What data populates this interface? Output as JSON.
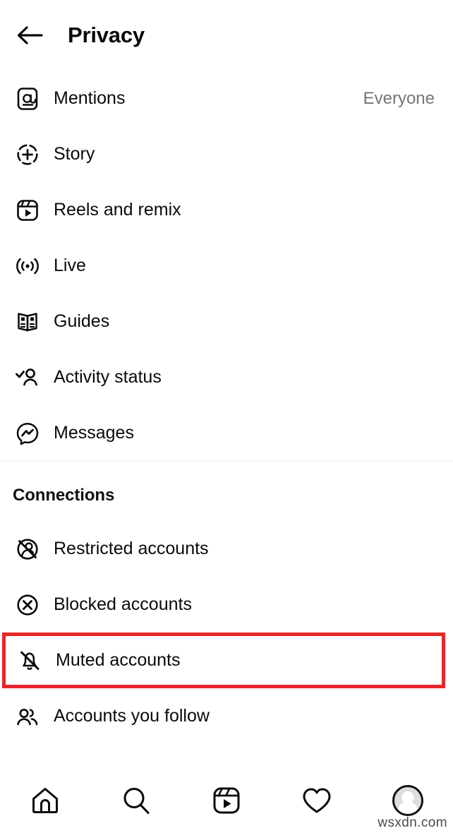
{
  "header": {
    "back_icon": "arrow-left-icon",
    "title": "Privacy"
  },
  "main": {
    "interactions_items": [
      {
        "label": "Mentions",
        "icon": "at-mention-icon",
        "value": "Everyone"
      },
      {
        "label": "Story",
        "icon": "story-plus-icon",
        "value": ""
      },
      {
        "label": "Reels and remix",
        "icon": "reels-icon",
        "value": ""
      },
      {
        "label": "Live",
        "icon": "live-broadcast-icon",
        "value": ""
      },
      {
        "label": "Guides",
        "icon": "guides-book-icon",
        "value": ""
      },
      {
        "label": "Activity status",
        "icon": "person-check-icon",
        "value": ""
      },
      {
        "label": "Messages",
        "icon": "messenger-icon",
        "value": ""
      }
    ],
    "connections_section_title": "Connections",
    "connections_items": [
      {
        "label": "Restricted accounts",
        "icon": "person-slash-circle-icon",
        "highlighted": false
      },
      {
        "label": "Blocked accounts",
        "icon": "x-circle-icon",
        "highlighted": false
      },
      {
        "label": "Muted accounts",
        "icon": "bell-slash-icon",
        "highlighted": true
      },
      {
        "label": "Accounts you follow",
        "icon": "two-people-icon",
        "highlighted": false
      }
    ]
  },
  "bottom_nav": {
    "items": [
      {
        "icon": "home-icon",
        "name": "nav-home"
      },
      {
        "icon": "search-icon",
        "name": "nav-search"
      },
      {
        "icon": "reels-icon",
        "name": "nav-reels"
      },
      {
        "icon": "heart-icon",
        "name": "nav-activity"
      },
      {
        "icon": "avatar-icon",
        "name": "nav-profile"
      }
    ]
  },
  "watermark": "wsxdn.com",
  "colors": {
    "highlight_border": "#e8262a",
    "text_primary": "#0a0a0a",
    "text_secondary": "#767676",
    "divider": "#efefef"
  }
}
